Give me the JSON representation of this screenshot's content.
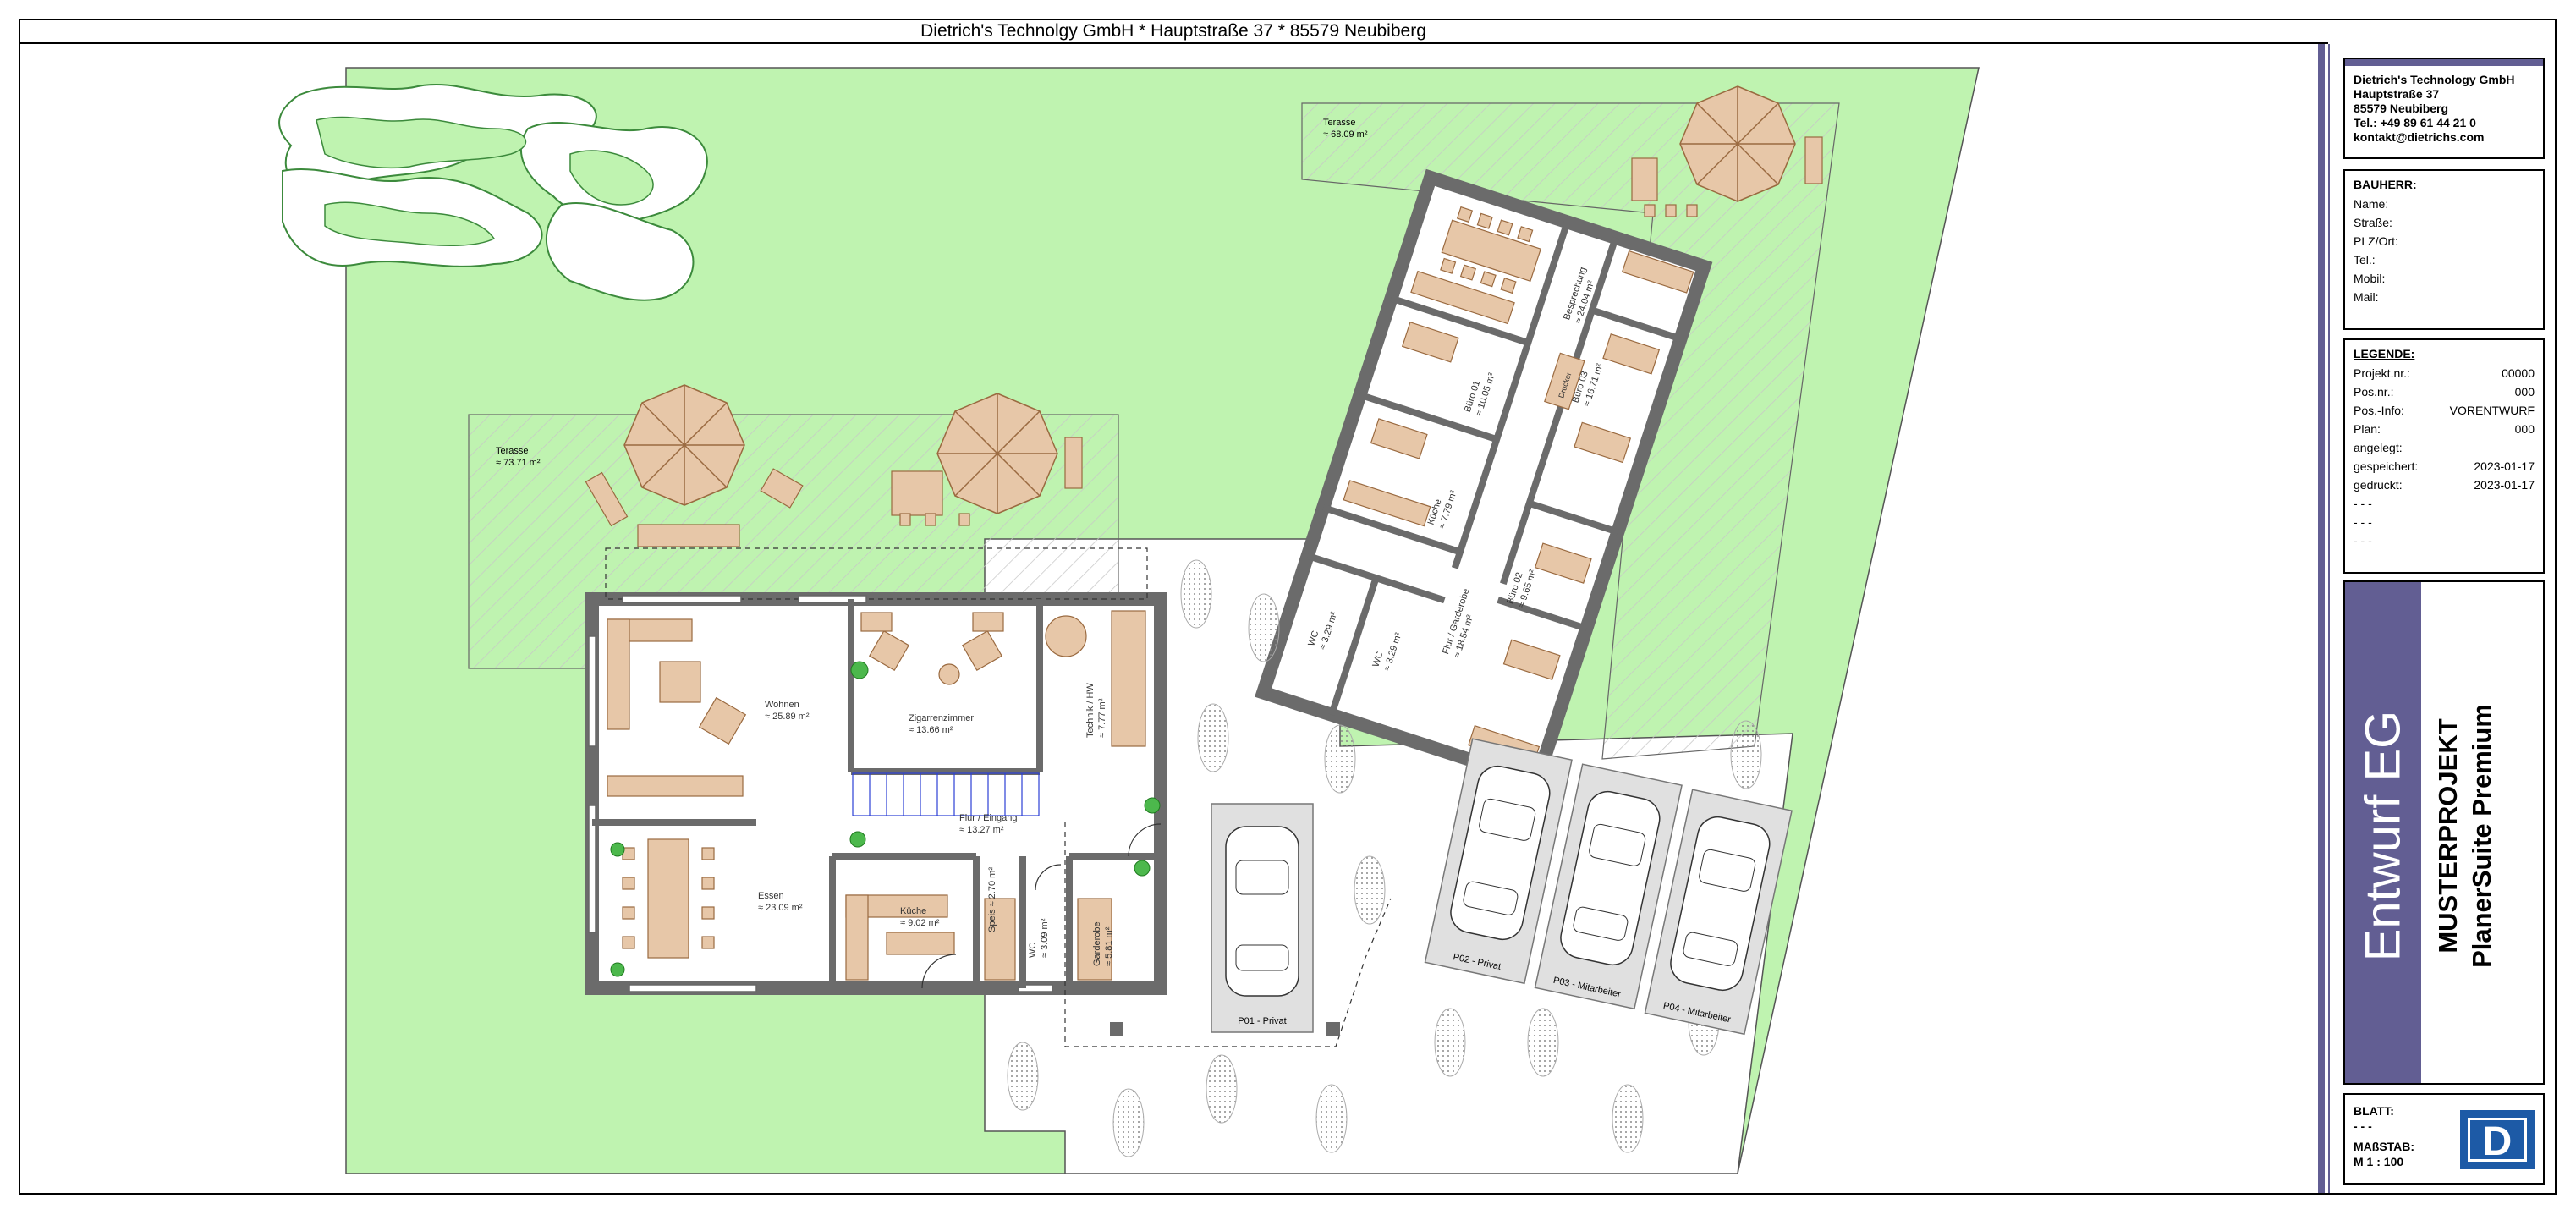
{
  "header": {
    "title": "Dietrich's Technolgy GmbH * Hauptstraße 37 * 85579 Neubiberg"
  },
  "company": {
    "name": "Dietrich's Technology GmbH",
    "street": "Hauptstraße 37",
    "city": "85579 Neubiberg",
    "tel": "Tel.: +49 89 61 44 21 0",
    "email": "kontakt@dietrichs.com"
  },
  "bauherr": {
    "heading": "BAUHERR:",
    "fields": [
      "Name:",
      "Straße:",
      "PLZ/Ort:",
      "Tel.:",
      "Mobil:",
      "Mail:"
    ]
  },
  "legende": {
    "heading": "LEGENDE:",
    "rows": [
      {
        "label": "Projekt.nr.:",
        "value": "00000"
      },
      {
        "label": "Pos.nr.:",
        "value": "000"
      },
      {
        "label": "Pos.-Info:",
        "value": "VORENTWURF"
      },
      {
        "label": "Plan:",
        "value": "000"
      },
      {
        "label": "angelegt:",
        "value": ""
      },
      {
        "label": "gespeichert:",
        "value": "2023-01-17"
      },
      {
        "label": "gedruckt:",
        "value": "2023-01-17"
      },
      {
        "label": " - - -",
        "value": ""
      },
      {
        "label": " - - -",
        "value": ""
      },
      {
        "label": " - - -",
        "value": ""
      }
    ]
  },
  "title_block": {
    "entwurf": "Entwurf EG",
    "project_line1": "MUSTERPROJEKT",
    "project_line2": "PlanerSuite Premium"
  },
  "blatt": {
    "blatt_label": "BLATT:",
    "blatt_value": "- - -",
    "massstab_label": "MAßSTAB:",
    "massstab_value": "M 1 : 100"
  },
  "logo": {
    "letter": "D",
    "color": "#1d5aa6"
  },
  "colors": {
    "lawn": "#bff3b0",
    "furniture": "#e7c7a8",
    "wall": "#6b6b6b",
    "accent": "#625e93",
    "stair": "#2b3fd6"
  },
  "plan": {
    "rooms": [
      {
        "name": "Wohnen",
        "area": "≈ 25.89 m²"
      },
      {
        "name": "Zigarrenzimmer",
        "area": "≈ 13.66 m²"
      },
      {
        "name": "Technik / HW",
        "area": "≈ 7.77 m²"
      },
      {
        "name": "Flur / Eingang",
        "area": "≈ 13.27 m²"
      },
      {
        "name": "Essen",
        "area": "≈ 23.09 m²"
      },
      {
        "name": "Küche",
        "area": "≈ 9.02 m²"
      },
      {
        "name": "Speis",
        "area": "≈ 2.70 m²"
      },
      {
        "name": "WC",
        "area": "≈ 3.09 m²"
      },
      {
        "name": "Garderobe",
        "area": "≈ 5.81 m²"
      }
    ],
    "terrace_main": {
      "name": "Terasse",
      "area": "≈ 73.71 m²"
    },
    "terrace_office": {
      "name": "Terasse",
      "area": "≈ 68.09 m²"
    },
    "office_rooms": [
      {
        "name": "Besprechung",
        "area": "≈ 24.04 m²"
      },
      {
        "name": "Büro 03",
        "area": "≈ 16.71 m²"
      },
      {
        "name": "Büro 01",
        "area": "≈ 10.05 m²"
      },
      {
        "name": "Küche",
        "area": "≈ 7.79 m²"
      },
      {
        "name": "Flur / Garderobe",
        "area": "≈ 18.54 m²"
      },
      {
        "name": "Büro 02",
        "area": "≈ 9.65 m²"
      },
      {
        "name": "WC",
        "area": "≈ 3.29 m²"
      },
      {
        "name": "WC",
        "area": "≈ 3.29 m²"
      },
      {
        "name": "Drucker",
        "area": ""
      }
    ],
    "parking": [
      {
        "label": "P01 - Privat"
      },
      {
        "label": "P02 - Privat"
      },
      {
        "label": "P03 - Mitarbeiter"
      },
      {
        "label": "P04 - Mitarbeiter"
      }
    ]
  }
}
